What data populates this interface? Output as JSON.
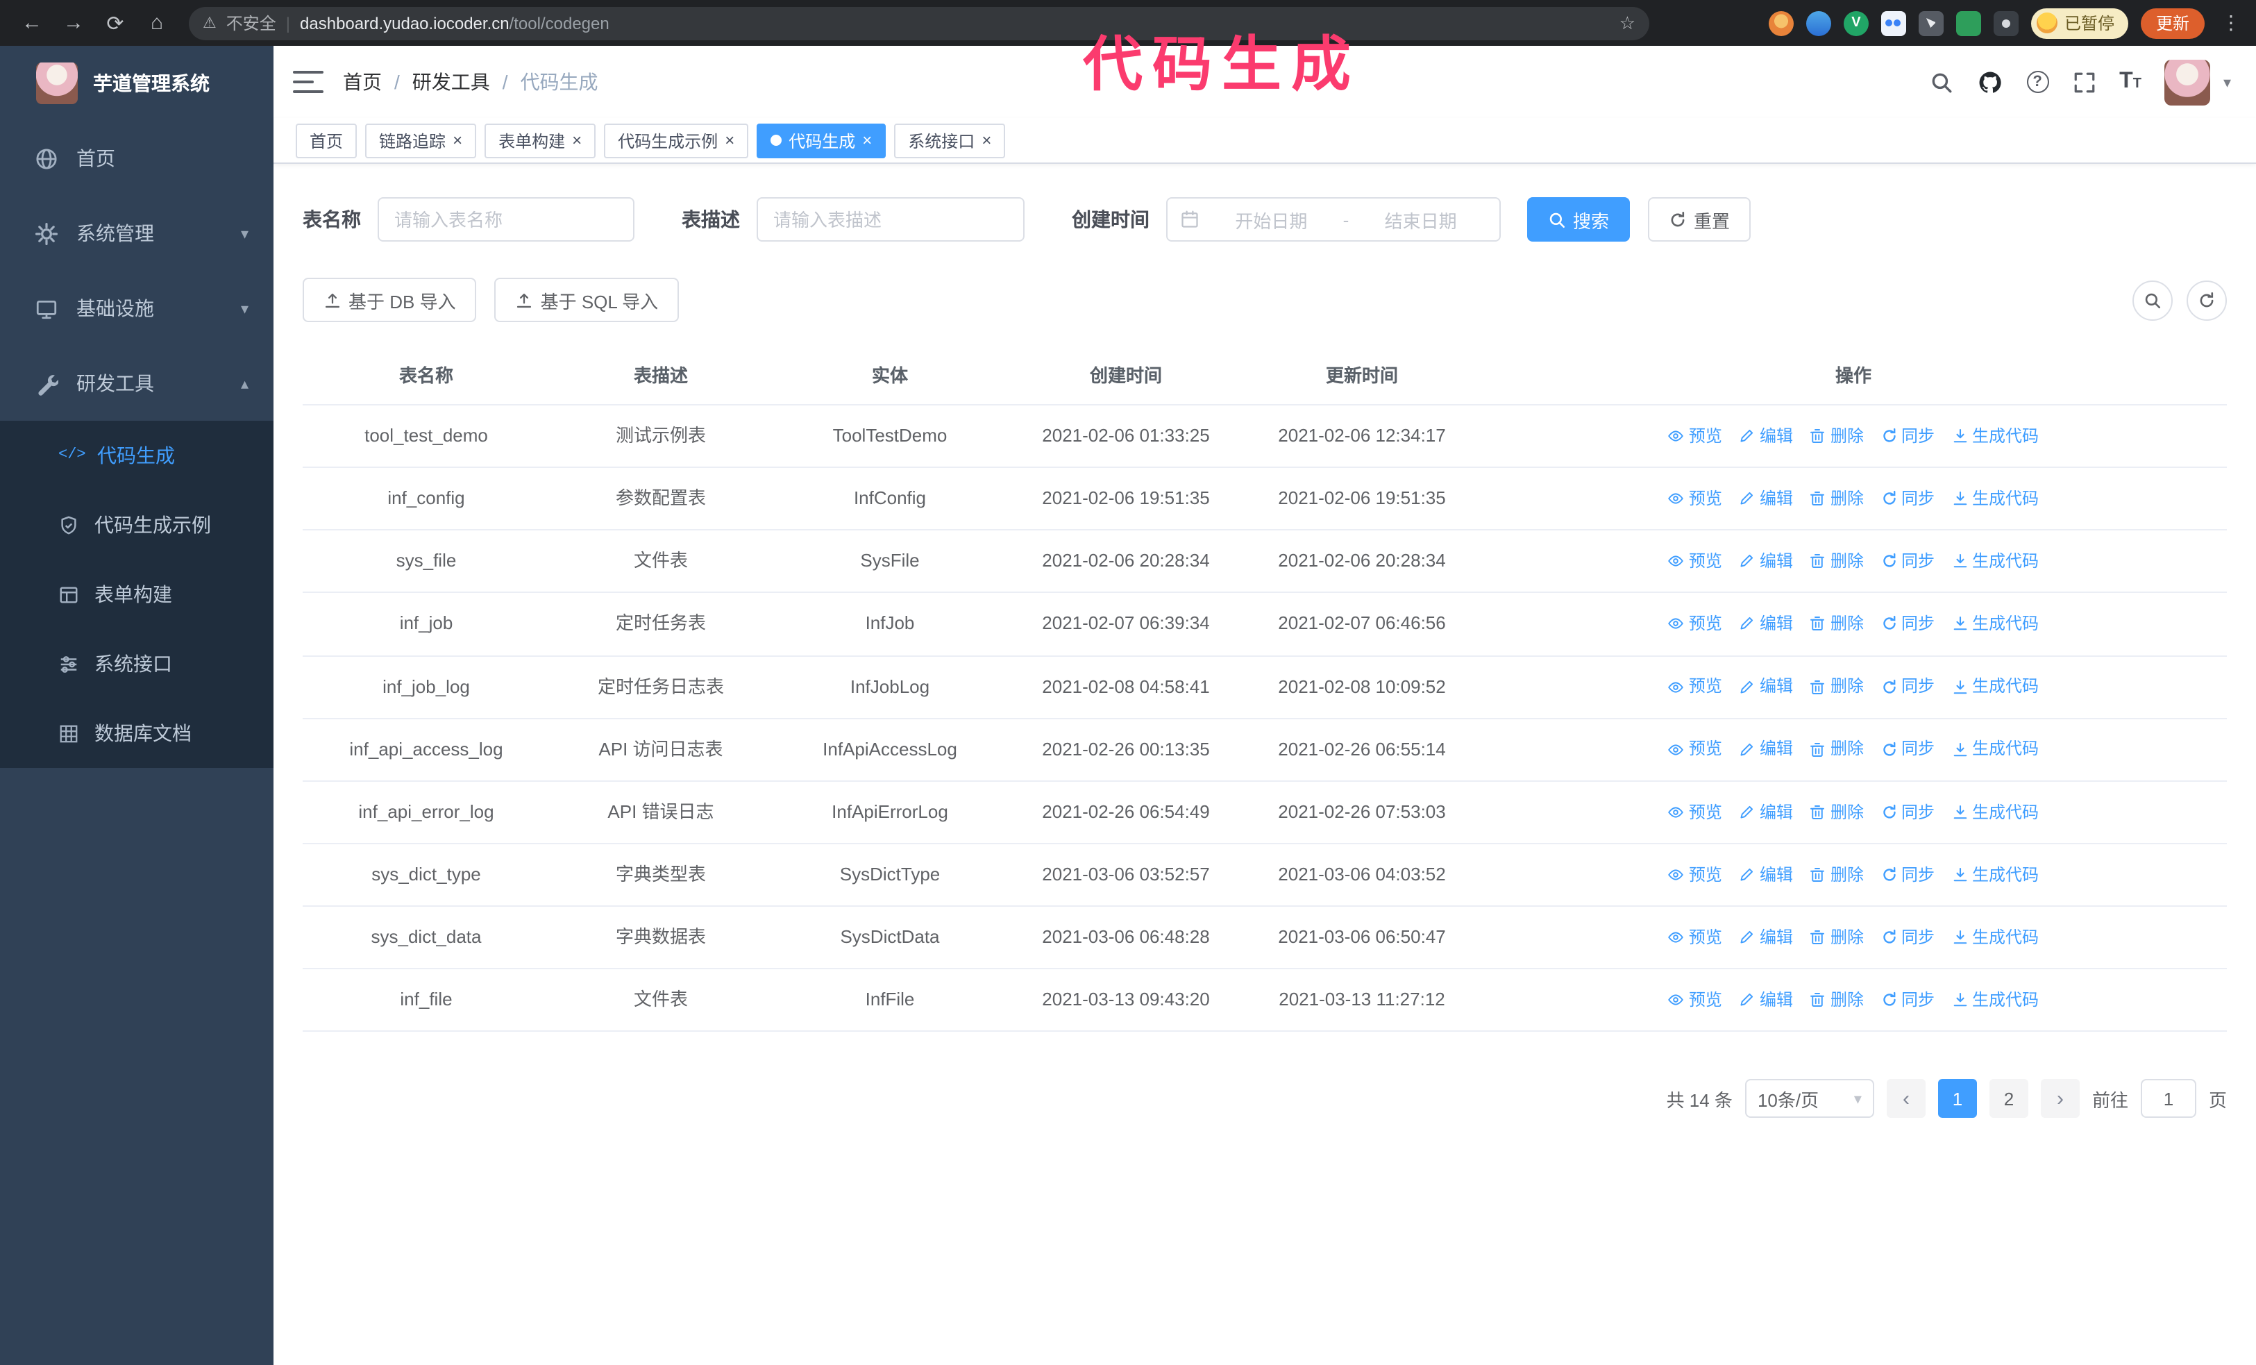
{
  "annotation": {
    "text": "代码生成"
  },
  "colors": {
    "primary": "#409eff",
    "sidebar_bg": "#304156",
    "submenu_bg": "#1f2d3d",
    "annotation": "#fb3b6e"
  },
  "browser": {
    "security_label": "不安全",
    "url_host": "dashboard.yudao.iocoder.cn",
    "url_path": "/tool/codegen",
    "paused_badge": "已暂停",
    "update_button": "更新"
  },
  "icons": {
    "back": "←",
    "forward": "→",
    "reload": "⟳",
    "home": "⌂",
    "warning": "⚠",
    "star": "☆",
    "divider": "|",
    "kebab": "⋮",
    "caret_down": "▾",
    "chevron_down": "▾",
    "chevron_up": "▴",
    "close": "×",
    "prev": "‹",
    "next": "›",
    "code": "</>",
    "question": "?",
    "ext_v": "V",
    "font_big": "T",
    "font_small": "T"
  },
  "sidebar": {
    "app_title": "芋道管理系统",
    "items": [
      {
        "label": "首页"
      },
      {
        "label": "系统管理"
      },
      {
        "label": "基础设施"
      },
      {
        "label": "研发工具"
      }
    ],
    "subitems": [
      {
        "label": "代码生成",
        "active": true
      },
      {
        "label": "代码生成示例"
      },
      {
        "label": "表单构建"
      },
      {
        "label": "系统接口"
      },
      {
        "label": "数据库文档"
      }
    ]
  },
  "header": {
    "breadcrumb": [
      "首页",
      "研发工具",
      "代码生成"
    ],
    "separator": "/"
  },
  "tabs": [
    {
      "label": "首页",
      "closable": false,
      "active": false
    },
    {
      "label": "链路追踪",
      "closable": true,
      "active": false
    },
    {
      "label": "表单构建",
      "closable": true,
      "active": false
    },
    {
      "label": "代码生成示例",
      "closable": true,
      "active": false
    },
    {
      "label": "代码生成",
      "closable": true,
      "active": true
    },
    {
      "label": "系统接口",
      "closable": true,
      "active": false
    }
  ],
  "filters": {
    "table_name_label": "表名称",
    "table_name_placeholder": "请输入表名称",
    "table_desc_label": "表描述",
    "table_desc_placeholder": "请输入表描述",
    "create_time_label": "创建时间",
    "date_start_placeholder": "开始日期",
    "date_separator": "-",
    "date_end_placeholder": "结束日期",
    "search_button": "搜索",
    "reset_button": "重置"
  },
  "toolbar": {
    "import_db": "基于 DB 导入",
    "import_sql": "基于 SQL 导入"
  },
  "table": {
    "columns": [
      "表名称",
      "表描述",
      "实体",
      "创建时间",
      "更新时间",
      "操作"
    ],
    "actions": [
      "预览",
      "编辑",
      "删除",
      "同步",
      "生成代码"
    ],
    "rows": [
      {
        "name": "tool_test_demo",
        "desc": "测试示例表",
        "entity": "ToolTestDemo",
        "created": "2021-02-06 01:33:25",
        "updated": "2021-02-06 12:34:17"
      },
      {
        "name": "inf_config",
        "desc": "参数配置表",
        "entity": "InfConfig",
        "created": "2021-02-06 19:51:35",
        "updated": "2021-02-06 19:51:35"
      },
      {
        "name": "sys_file",
        "desc": "文件表",
        "entity": "SysFile",
        "created": "2021-02-06 20:28:34",
        "updated": "2021-02-06 20:28:34"
      },
      {
        "name": "inf_job",
        "desc": "定时任务表",
        "entity": "InfJob",
        "created": "2021-02-07 06:39:34",
        "updated": "2021-02-07 06:46:56"
      },
      {
        "name": "inf_job_log",
        "desc": "定时任务日志表",
        "entity": "InfJobLog",
        "created": "2021-02-08 04:58:41",
        "updated": "2021-02-08 10:09:52"
      },
      {
        "name": "inf_api_access_log",
        "desc": "API 访问日志表",
        "entity": "InfApiAccessLog",
        "created": "2021-02-26 00:13:35",
        "updated": "2021-02-26 06:55:14"
      },
      {
        "name": "inf_api_error_log",
        "desc": "API 错误日志",
        "entity": "InfApiErrorLog",
        "created": "2021-02-26 06:54:49",
        "updated": "2021-02-26 07:53:03"
      },
      {
        "name": "sys_dict_type",
        "desc": "字典类型表",
        "entity": "SysDictType",
        "created": "2021-03-06 03:52:57",
        "updated": "2021-03-06 04:03:52"
      },
      {
        "name": "sys_dict_data",
        "desc": "字典数据表",
        "entity": "SysDictData",
        "created": "2021-03-06 06:48:28",
        "updated": "2021-03-06 06:50:47"
      },
      {
        "name": "inf_file",
        "desc": "文件表",
        "entity": "InfFile",
        "created": "2021-03-13 09:43:20",
        "updated": "2021-03-13 11:27:12"
      }
    ]
  },
  "pagination": {
    "total": "共 14 条",
    "page_size": "10条/页",
    "pages": [
      {
        "label": "1",
        "active": true
      },
      {
        "label": "2",
        "active": false
      }
    ],
    "goto_label": "前往",
    "goto_value": "1",
    "page_unit": "页"
  }
}
